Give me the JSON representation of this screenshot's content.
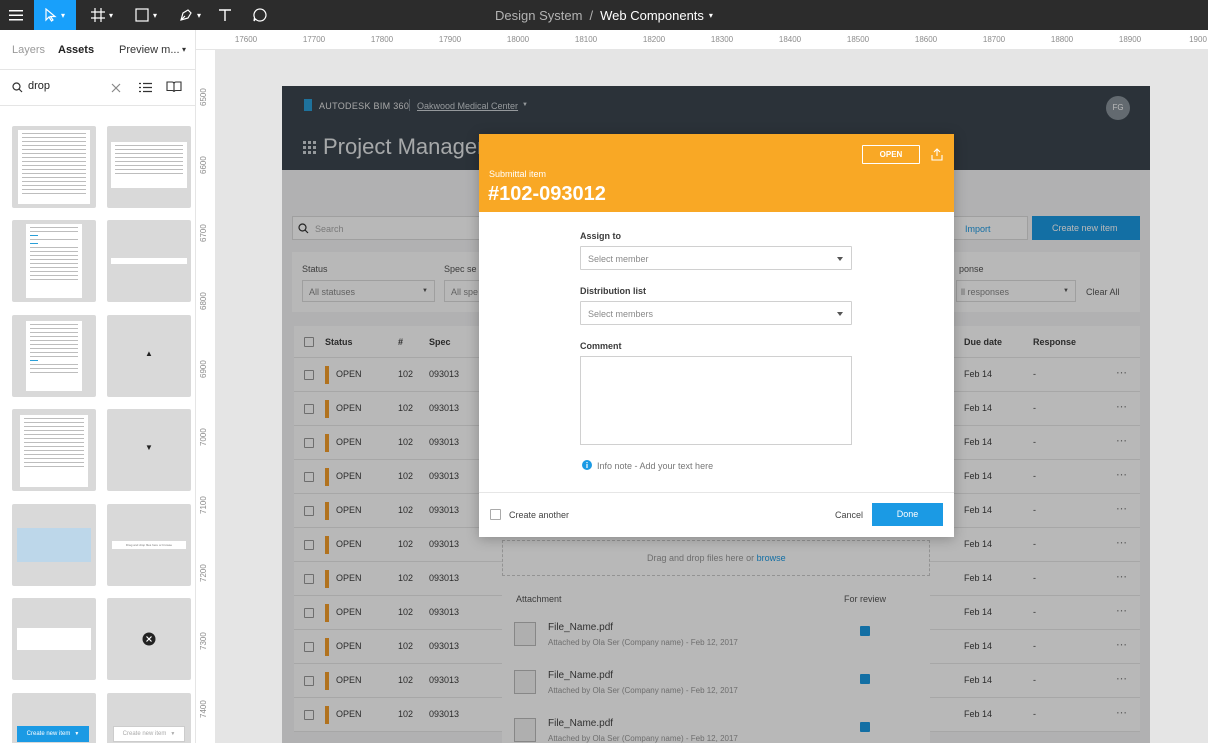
{
  "toolbar": {
    "menu_icon": "hamburger-icon",
    "tools": [
      "move-tool-icon",
      "frame-tool-icon",
      "shape-tool-icon",
      "pen-tool-icon",
      "text-tool-icon",
      "comment-tool-icon"
    ],
    "project": "Design System",
    "separator": "/",
    "file": "Web Components"
  },
  "left_panel": {
    "tabs": [
      "Layers",
      "Assets",
      "Preview m..."
    ],
    "search_value": "drop",
    "bottom_thumbs": {
      "create_new_item": "Create new item",
      "create_new_item_outline": "Create new item"
    },
    "thumb_snippets": {
      "drag_drop": "Drag and drop files here or browse"
    }
  },
  "ruler": {
    "x_labels": [
      "17600",
      "17700",
      "17800",
      "17900",
      "18000",
      "18100",
      "18200",
      "18300",
      "18400",
      "18500",
      "18600",
      "18700",
      "18800",
      "18900",
      "1900"
    ],
    "y_labels": [
      "6500",
      "6600",
      "6700",
      "6800",
      "6900",
      "7000",
      "7100",
      "7200",
      "7300",
      "7400"
    ]
  },
  "app": {
    "brand": "AUTODESK BIM 360",
    "project": "Oakwood Medical Center",
    "avatar": "FG",
    "page_title": "Project Management",
    "search_placeholder": "Search",
    "import_label": "Import",
    "create_new_label": "Create new item",
    "filters": {
      "status_label": "Status",
      "status_value": "All statuses",
      "spec_label": "Spec se",
      "spec_value": "All spe",
      "response_label": "ponse",
      "response_value": "ll responses",
      "clear_all": "Clear All"
    },
    "columns": [
      "Status",
      "#",
      "Spec",
      "Due date",
      "Response"
    ],
    "rows": [
      {
        "status": "OPEN",
        "num": "102",
        "spec": "093013",
        "due": "Feb 14",
        "resp": "-"
      },
      {
        "status": "OPEN",
        "num": "102",
        "spec": "093013",
        "due": "Feb 14",
        "resp": "-"
      },
      {
        "status": "OPEN",
        "num": "102",
        "spec": "093013",
        "due": "Feb 14",
        "resp": "-"
      },
      {
        "status": "OPEN",
        "num": "102",
        "spec": "093013",
        "due": "Feb 14",
        "resp": "-"
      },
      {
        "status": "OPEN",
        "num": "102",
        "spec": "093013",
        "due": "Feb 14",
        "resp": "-"
      },
      {
        "status": "OPEN",
        "num": "102",
        "spec": "093013",
        "due": "Feb 14",
        "resp": "-"
      },
      {
        "status": "OPEN",
        "num": "102",
        "spec": "093013",
        "due": "Feb 14",
        "resp": "-"
      },
      {
        "status": "OPEN",
        "num": "102",
        "spec": "093013",
        "due": "Feb 14",
        "resp": "-"
      },
      {
        "status": "OPEN",
        "num": "102",
        "spec": "093013",
        "due": "Feb 14",
        "resp": "-"
      },
      {
        "status": "OPEN",
        "num": "102",
        "spec": "093013",
        "due": "Feb 14",
        "resp": "-"
      },
      {
        "status": "OPEN",
        "num": "102",
        "spec": "093013",
        "due": "Feb 14",
        "resp": "-"
      }
    ],
    "drop_zone": "Drag and drop files here",
    "drop_or": "or",
    "drop_browse": "browse",
    "attachment_header": "Attachment",
    "for_review_header": "For review",
    "attachments": [
      {
        "name": "File_Name.pdf",
        "meta": "Attached by Ola Ser (Company name) - Feb 12, 2017"
      },
      {
        "name": "File_Name.pdf",
        "meta": "Attached by Ola Ser (Company name) - Feb 12, 2017"
      },
      {
        "name": "File_Name.pdf",
        "meta": "Attached by Ola Ser (Company name) - Feb 12, 2017"
      }
    ]
  },
  "modal": {
    "status_button": "OPEN",
    "subtitle": "Submittal item",
    "title": "#102-093012",
    "assign_label": "Assign to",
    "assign_placeholder": "Select member",
    "distribution_label": "Distribution list",
    "distribution_placeholder": "Select members",
    "comment_label": "Comment",
    "info_note": "Info note - Add your text here",
    "create_another": "Create another",
    "cancel": "Cancel",
    "done": "Done"
  },
  "colors": {
    "accent_orange": "#f9a825",
    "primary_blue": "#1b9ae4",
    "dark_header": "#3c4650"
  }
}
